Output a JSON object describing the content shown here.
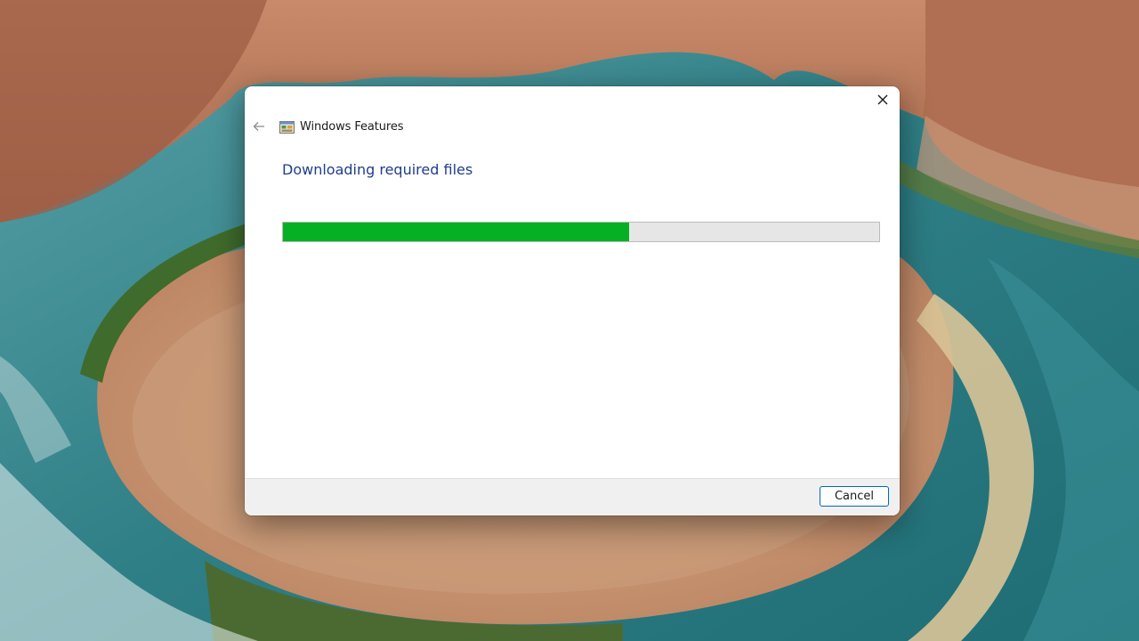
{
  "window": {
    "title": "Windows Features",
    "heading": "Downloading required files"
  },
  "progress": {
    "fraction": 0.58,
    "color": "#06b025"
  },
  "buttons": {
    "cancel_label": "Cancel"
  },
  "icons": {
    "close": "close-icon",
    "back": "back-arrow-icon",
    "app": "windows-features-icon"
  },
  "colors": {
    "heading": "#1f3d8c",
    "cancel_border": "#0067c0"
  }
}
